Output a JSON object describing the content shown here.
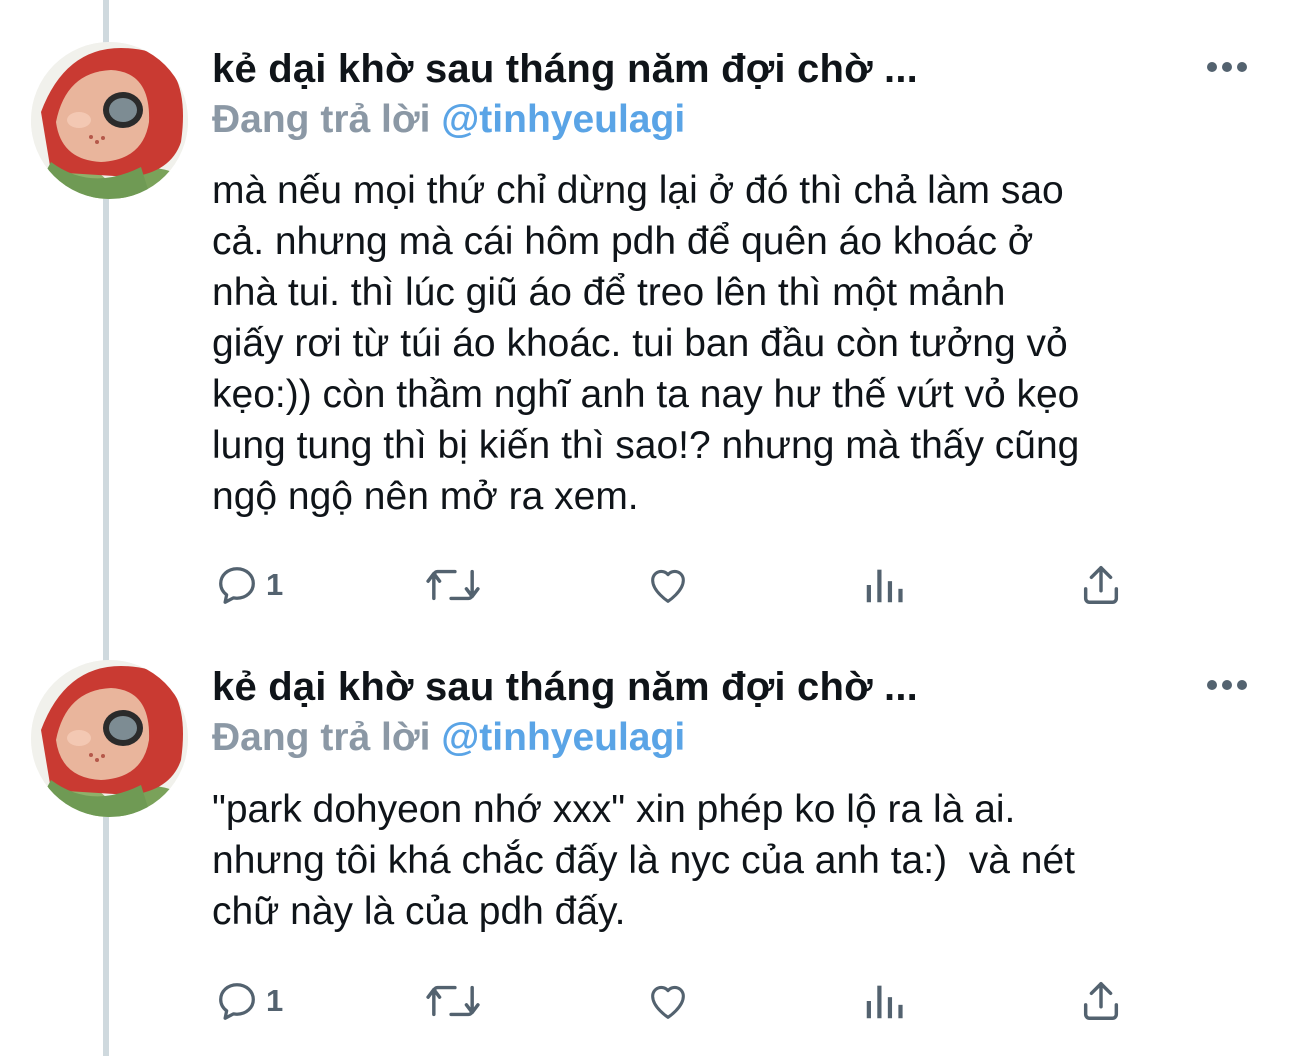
{
  "tweets": [
    {
      "author": "kẻ dại khờ sau tháng năm đợi chờ ...",
      "reply_prefix": "Đang trả lời ",
      "reply_handle": "@tinhyeulagi",
      "text": "mà nếu mọi thứ chỉ dừng lại ở đó thì chả làm sao\ncả. nhưng mà cái hôm pdh để quên áo khoác ở\nnhà tui. thì lúc giũ áo để treo lên thì một mảnh\ngiấy rơi từ túi áo khoác. tui ban đầu còn tưởng vỏ\nkẹo:)) còn thầm nghĩ anh ta nay hư thế vứt vỏ kẹo\nlung tung thì bị kiến thì sao!? nhưng mà thấy cũng\nngộ ngộ nên mở ra xem.",
      "reply_count": "1"
    },
    {
      "author": "kẻ dại khờ sau tháng năm đợi chờ ...",
      "reply_prefix": "Đang trả lời ",
      "reply_handle": "@tinhyeulagi",
      "text": "\"park dohyeon nhớ xxx\" xin phép ko lộ ra là ai.\nnhưng tôi khá chắc đấy là nyc của anh ta:)  và nét\nchữ này là của pdh đấy.",
      "reply_count": "1"
    }
  ],
  "icons": {
    "avatar": "avatar-image",
    "more": "more-icon",
    "reply": "reply-icon",
    "retweet": "retweet-icon",
    "like": "like-icon",
    "views": "views-icon",
    "share": "share-icon"
  },
  "colors": {
    "text": "#0f1419",
    "muted": "#8b98a5",
    "link": "#5aa4e6",
    "icon": "#53626f",
    "thread_line": "#cfd9de"
  }
}
